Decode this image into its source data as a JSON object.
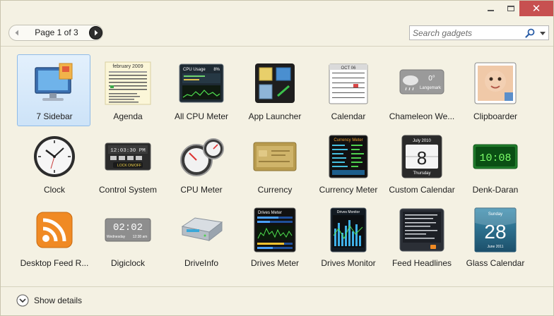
{
  "window": {
    "controls": {
      "minimize": "minimize-icon",
      "maximize": "maximize-icon",
      "close": "close-icon",
      "close_color": "#c75050"
    }
  },
  "toolbar": {
    "page_label": "Page 1 of 3",
    "search_placeholder": "Search gadgets"
  },
  "gadgets": [
    {
      "label": "7 Sidebar",
      "icon": "monitor-icon",
      "selected": true
    },
    {
      "label": "Agenda",
      "icon": "agenda-calendar-icon",
      "selected": false
    },
    {
      "label": "All CPU Meter",
      "icon": "cpu-usage-graph-icon",
      "selected": false
    },
    {
      "label": "App Launcher",
      "icon": "app-launcher-icon",
      "selected": false
    },
    {
      "label": "Calendar",
      "icon": "calendar-icon",
      "selected": false
    },
    {
      "label": "Chameleon We...",
      "icon": "weather-icon",
      "selected": false
    },
    {
      "label": "Clipboarder",
      "icon": "clipboard-photo-icon",
      "selected": false
    },
    {
      "label": "Clock",
      "icon": "analog-clock-icon",
      "selected": false
    },
    {
      "label": "Control System",
      "icon": "control-system-icon",
      "selected": false
    },
    {
      "label": "CPU Meter",
      "icon": "gauge-meter-icon",
      "selected": false
    },
    {
      "label": "Currency",
      "icon": "currency-card-icon",
      "selected": false
    },
    {
      "label": "Currency Meter",
      "icon": "currency-meter-icon",
      "selected": false
    },
    {
      "label": "Custom Calendar",
      "icon": "flip-calendar-icon",
      "selected": false
    },
    {
      "label": "Denk-Daran",
      "icon": "digital-display-icon",
      "selected": false
    },
    {
      "label": "Desktop Feed R...",
      "icon": "rss-feed-icon",
      "selected": false
    },
    {
      "label": "Digiclock",
      "icon": "digital-clock-icon",
      "selected": false
    },
    {
      "label": "DriveInfo",
      "icon": "hard-drive-icon",
      "selected": false
    },
    {
      "label": "Drives Meter",
      "icon": "drives-meter-icon",
      "selected": false
    },
    {
      "label": "Drives Monitor",
      "icon": "drives-monitor-icon",
      "selected": false
    },
    {
      "label": "Feed Headlines",
      "icon": "feed-headlines-icon",
      "selected": false
    },
    {
      "label": "Glass Calendar",
      "icon": "glass-calendar-icon",
      "selected": false
    }
  ],
  "thumb_text": {
    "agenda_title": "february 2009",
    "cpu_title": "CPU Usage",
    "cpu_pct": "8%",
    "calendar_month": "OCT 06",
    "weather_temp": "0°",
    "weather_place": "Langemark",
    "control_time": "12:03:30 PM",
    "control_lock": "LOCK ON/OFF",
    "currency_meter_title": "Currency Meter",
    "custom_cal_month": "July 2010",
    "custom_cal_day": "8",
    "custom_cal_weekday": "Thursday",
    "denk_display": "10:08",
    "digiclock_time": "02:02",
    "digiclock_day": "Wednesday",
    "digiclock_clock": "12:38 am",
    "drives_meter_title": "Drives Meter",
    "drives_monitor_title": "Drives Monitor",
    "glass_cal_weekday": "Sunday",
    "glass_cal_day": "28",
    "glass_cal_month": "June 2011"
  },
  "footer": {
    "details_label": "Show details"
  }
}
